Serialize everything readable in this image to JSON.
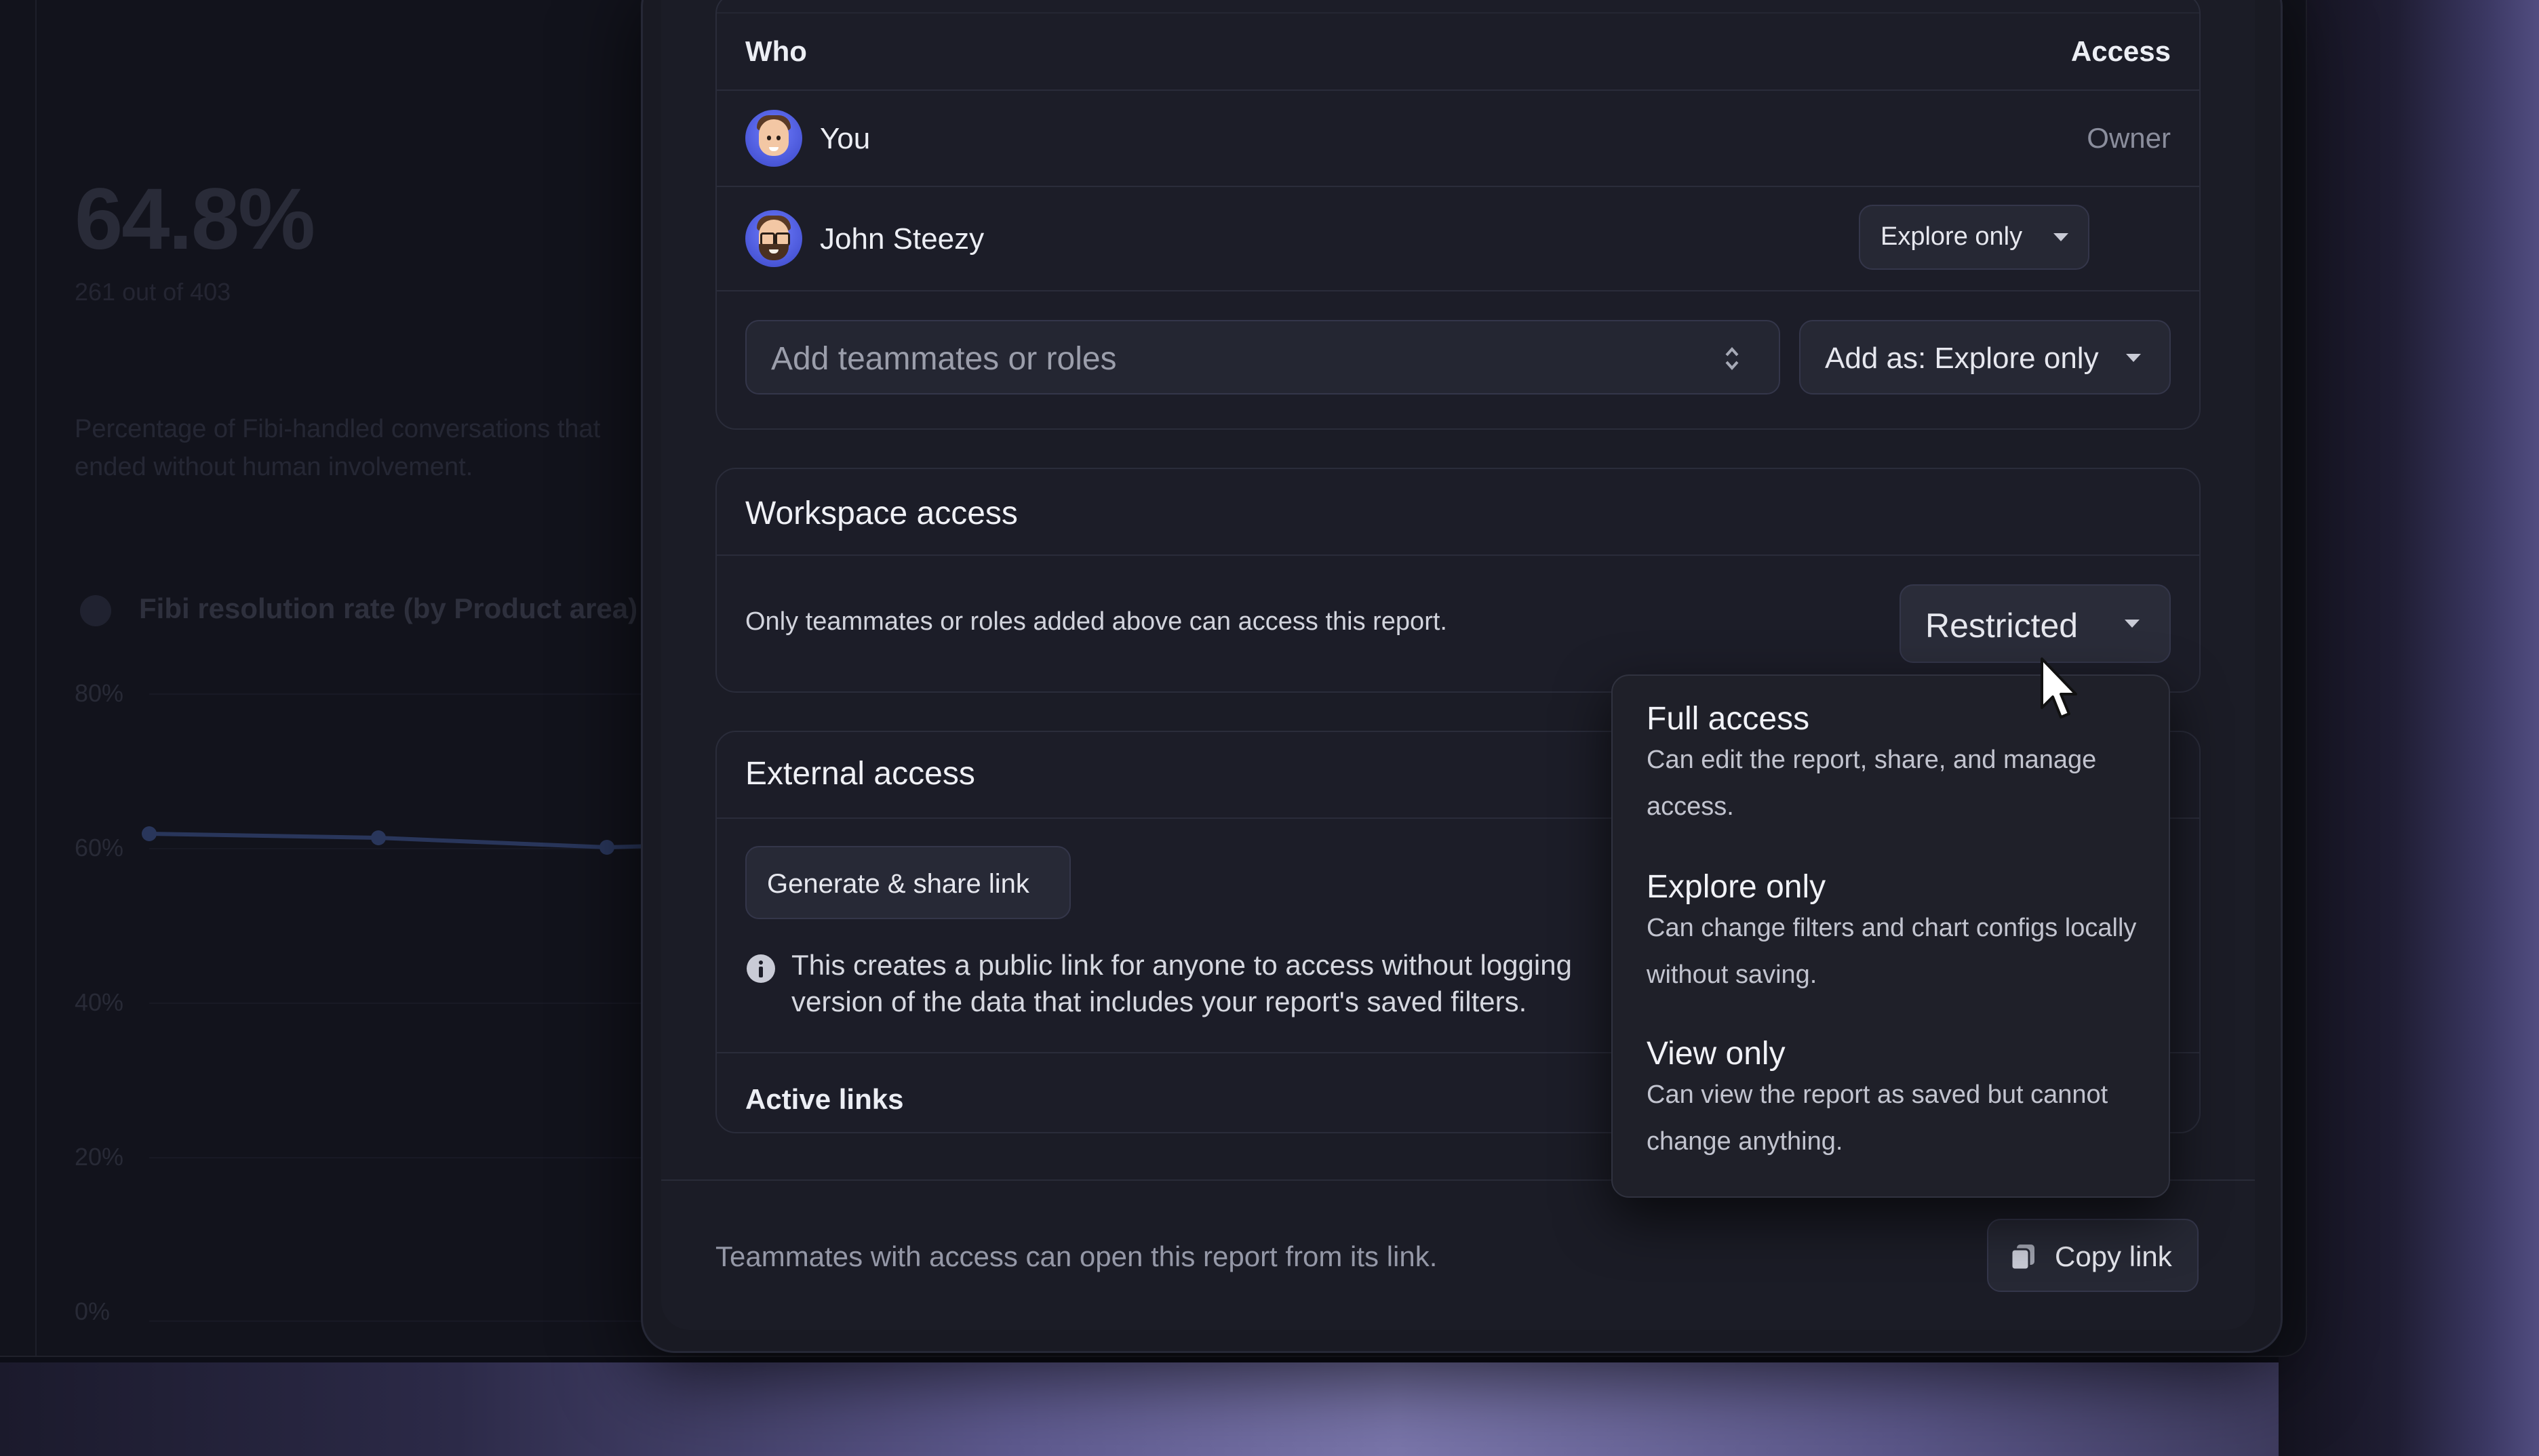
{
  "background": {
    "stat_value": "64.8%",
    "stat_sub": "261 out of 403",
    "description": "Percentage of Fibi-handled conversations that ended without human involvement.",
    "chart_title": "Fibi resolution rate (by Product area)",
    "y_ticks": [
      "80%",
      "60%",
      "40%",
      "20%",
      "0%"
    ]
  },
  "share": {
    "who_header": "Who",
    "access_header": "Access",
    "people": [
      {
        "name": "You",
        "access": "Owner"
      },
      {
        "name": "John Steezy",
        "access": "Explore only"
      }
    ],
    "add_placeholder": "Add teammates or roles",
    "add_as_label": "Add as: Explore only"
  },
  "workspace": {
    "title": "Workspace access",
    "description": "Only teammates or roles added above can access this report.",
    "selected": "Restricted"
  },
  "external": {
    "title": "External access",
    "generate_button": "Generate & share link",
    "info_line1": "This creates a public link for anyone to access without logging",
    "info_line2": "version of the data that includes your report's saved filters.",
    "active_links": "Active links"
  },
  "access_menu": {
    "options": [
      {
        "title": "Full access",
        "desc": "Can edit the report, share, and manage access."
      },
      {
        "title": "Explore only",
        "desc": "Can change filters and chart configs locally without saving."
      },
      {
        "title": "View only",
        "desc": "Can view the report as saved but cannot change anything."
      }
    ]
  },
  "footer": {
    "note": "Teammates with access can open this report from its link.",
    "copy_link": "Copy link"
  },
  "colors": {
    "accent_avatar": "#5562e6",
    "chart_line": "#5b7fe0"
  }
}
